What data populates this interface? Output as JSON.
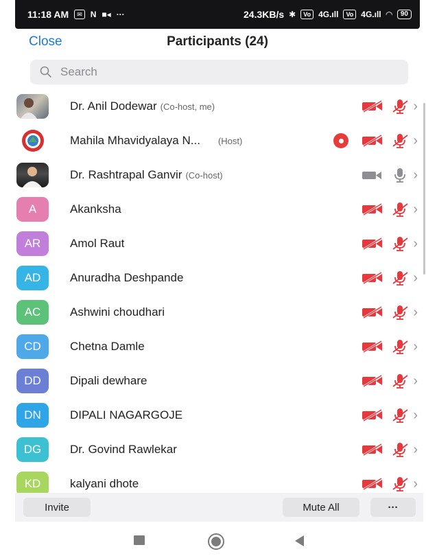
{
  "status_bar": {
    "time": "11:18 AM",
    "network_speed": "24.3KB/s",
    "battery": "90",
    "sim1": "4G",
    "sim2": "4G"
  },
  "header": {
    "close_label": "Close",
    "title": "Participants (24)"
  },
  "search": {
    "placeholder": "Search"
  },
  "colors": {
    "accent": "#1f7ad6",
    "muted_red": "#e8383d",
    "record_red": "#e83b3b",
    "unmuted_gray": "#8e8e93"
  },
  "participants": [
    {
      "name": "Dr. Anil Dodewar",
      "role": "(Co-host, me)",
      "avatar_type": "photo",
      "video_muted": true,
      "audio_muted": true
    },
    {
      "name": "Mahila Mhavidyalaya N...",
      "role": "(Host)",
      "avatar_type": "logo",
      "recording": true,
      "video_muted": true,
      "audio_muted": true
    },
    {
      "name": "Dr. Rashtrapal Ganvir",
      "role": "(Co-host)",
      "avatar_type": "photo",
      "video_muted": false,
      "audio_muted": false
    },
    {
      "name": "Akanksha",
      "initials": "A",
      "color": "#e57fb0",
      "video_muted": true,
      "audio_muted": true
    },
    {
      "name": "Amol Raut",
      "initials": "AR",
      "color": "#c17fdb",
      "video_muted": true,
      "audio_muted": true
    },
    {
      "name": "Anuradha Deshpande",
      "initials": "AD",
      "color": "#37b4e6",
      "video_muted": true,
      "audio_muted": true
    },
    {
      "name": "Ashwini choudhari",
      "initials": "AC",
      "color": "#5cc27a",
      "video_muted": true,
      "audio_muted": true
    },
    {
      "name": "Chetna Damle",
      "initials": "CD",
      "color": "#4fa9e8",
      "video_muted": true,
      "audio_muted": true
    },
    {
      "name": "Dipali dewhare",
      "initials": "DD",
      "color": "#6b7fd4",
      "video_muted": true,
      "audio_muted": true
    },
    {
      "name": "DIPALI NAGARGOJE",
      "initials": "DN",
      "color": "#2fa5e8",
      "video_muted": true,
      "audio_muted": true
    },
    {
      "name": "Dr. Govind Rawlekar",
      "initials": "DG",
      "color": "#3cc1d3",
      "video_muted": true,
      "audio_muted": true
    },
    {
      "name": "kalyani dhote",
      "initials": "KD",
      "color": "#a9d65e",
      "video_muted": true,
      "audio_muted": true
    }
  ],
  "bottom_bar": {
    "invite_label": "Invite",
    "mute_all_label": "Mute All",
    "more_label": "···"
  }
}
